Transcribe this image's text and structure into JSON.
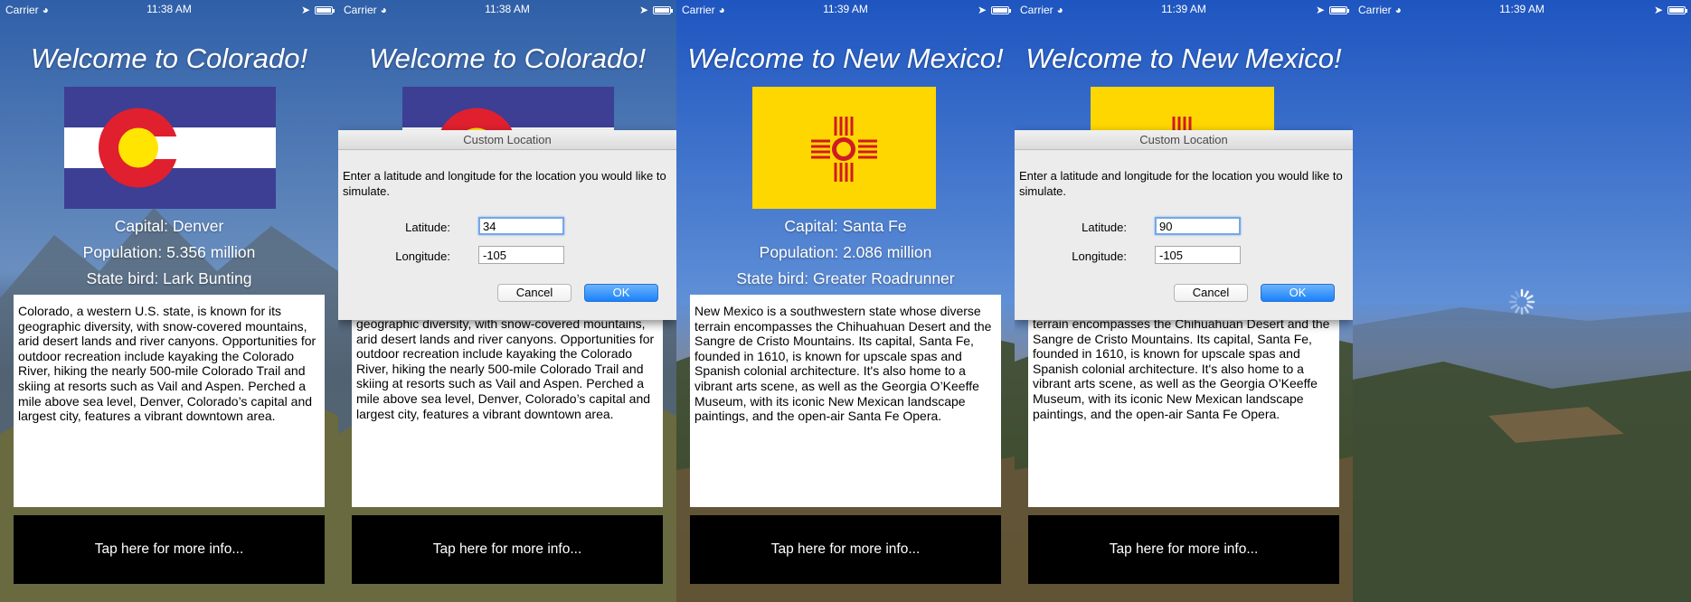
{
  "status": {
    "carrier": "Carrier",
    "times": [
      "11:38 AM",
      "11:38 AM",
      "11:39 AM",
      "11:39 AM",
      "11:39 AM"
    ]
  },
  "colorado": {
    "title": "Welcome to Colorado!",
    "capital": "Capital: Denver",
    "population": "Population: 5.356 million",
    "bird": "State bird: Lark Bunting",
    "description": "Colorado, a western U.S. state, is known for its geographic diversity, with snow-covered mountains, arid desert lands and river canyons. Opportunities for outdoor recreation include kayaking the Colorado River, hiking the nearly 500-mile Colorado Trail and skiing at resorts such as Vail and Aspen. Perched a mile above sea level, Denver, Colorado’s capital and largest city, features a vibrant downtown area.",
    "description_partial": "geographic diversity, with snow-covered mountains, arid desert lands and river canyons. Opportunities for outdoor recreation include kayaking the Colorado River, hiking the nearly 500-mile Colorado Trail and skiing at resorts such as Vail and Aspen. Perched a mile above sea level, Denver, Colorado’s capital and largest city, features a vibrant downtown area.",
    "flag_colors": {
      "blue": "#3c3f94",
      "white": "#ffffff",
      "red": "#e0202f",
      "gold": "#ffe500"
    }
  },
  "new_mexico": {
    "title": "Welcome to New Mexico!",
    "capital": "Capital: Santa Fe",
    "population": "Population: 2.086 million",
    "bird": "State bird: Greater Roadrunner",
    "description": "New Mexico is a southwestern state whose diverse terrain encompasses the Chihuahuan Desert and the Sangre de Cristo Mountains. Its capital, Santa Fe, founded in 1610, is known for upscale spas and Spanish colonial architecture. It's also home to a vibrant arts scene, as well as the Georgia O’Keeffe Museum, with its iconic New Mexican landscape paintings, and the open-air Santa Fe Opera.",
    "description_partial": "terrain encompasses the Chihuahuan Desert and the Sangre de Cristo Mountains. Its capital, Santa Fe, founded in 1610, is known for upscale spas and Spanish colonial architecture. It's also home to a vibrant arts scene, as well as the Georgia O’Keeffe Museum, with its iconic New Mexican landscape paintings, and the open-air Santa Fe Opera.",
    "flag_colors": {
      "yellow": "#ffd700",
      "red": "#d01a25"
    }
  },
  "more_button": "Tap here for more info...",
  "dialog": {
    "title": "Custom Location",
    "message": "Enter a latitude and longitude for the location you would like to simulate.",
    "latitude_label": "Latitude:",
    "longitude_label": "Longitude:",
    "cancel": "Cancel",
    "ok": "OK",
    "first": {
      "latitude": "34",
      "longitude": "-105"
    },
    "second": {
      "latitude": "90",
      "longitude": "-105"
    }
  },
  "icons": [
    "wifi-icon",
    "location-arrow-icon",
    "battery-icon",
    "loading-spinner-icon"
  ],
  "colors": {
    "ok_button": "#1a82fb",
    "field_focus": "#76a7e8"
  }
}
